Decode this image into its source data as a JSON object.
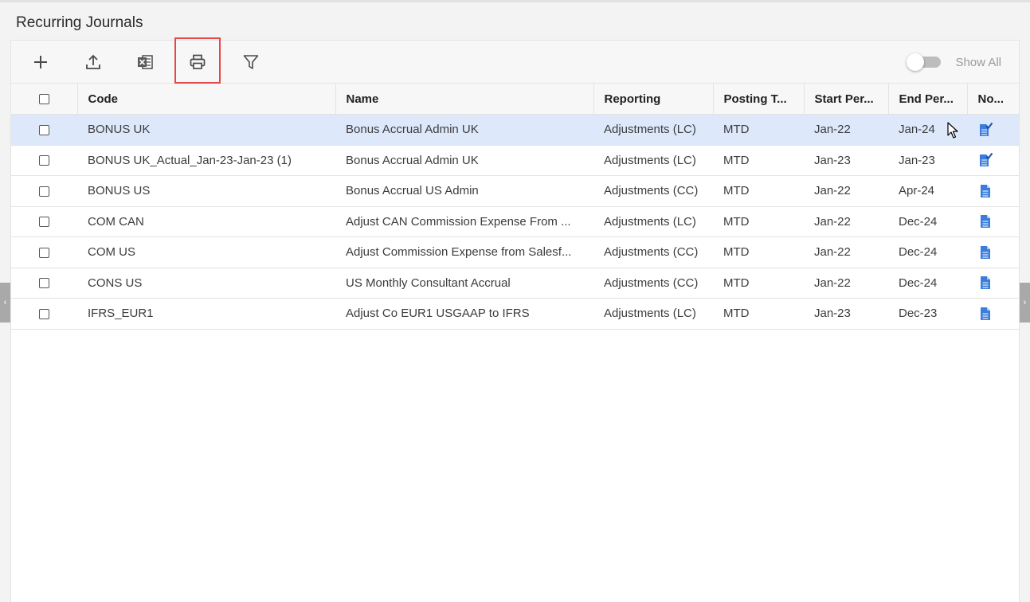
{
  "page": {
    "title": "Recurring Journals"
  },
  "toolbar": {
    "buttons": [
      {
        "name": "add-button",
        "icon": "plus-icon"
      },
      {
        "name": "upload-button",
        "icon": "upload-icon"
      },
      {
        "name": "excel-export-button",
        "icon": "excel-icon"
      },
      {
        "name": "print-button",
        "icon": "printer-icon"
      },
      {
        "name": "filter-button",
        "icon": "filter-icon"
      }
    ],
    "show_all_label": "Show All",
    "show_all_enabled": false
  },
  "table": {
    "columns": [
      "Code",
      "Name",
      "Reporting",
      "Posting T...",
      "Start Per...",
      "End Per...",
      "No..."
    ],
    "rows": [
      {
        "code": "BONUS UK",
        "name": "Bonus Accrual Admin UK",
        "reporting": "Adjustments (LC)",
        "posting": "MTD",
        "start": "Jan-22",
        "end": "Jan-24",
        "note_icon": "note-check-icon",
        "selected": true
      },
      {
        "code": "BONUS UK_Actual_Jan-23-Jan-23 (1)",
        "name": "Bonus Accrual Admin UK",
        "reporting": "Adjustments (LC)",
        "posting": "MTD",
        "start": "Jan-23",
        "end": "Jan-23",
        "note_icon": "note-check-icon",
        "selected": false
      },
      {
        "code": "BONUS US",
        "name": "Bonus Accrual US Admin",
        "reporting": "Adjustments (CC)",
        "posting": "MTD",
        "start": "Jan-22",
        "end": "Apr-24",
        "note_icon": "note-icon",
        "selected": false
      },
      {
        "code": "COM CAN",
        "name": "Adjust CAN Commission Expense From ...",
        "reporting": "Adjustments (LC)",
        "posting": "MTD",
        "start": "Jan-22",
        "end": "Dec-24",
        "note_icon": "note-icon",
        "selected": false
      },
      {
        "code": "COM US",
        "name": "Adjust Commission Expense from Salesf...",
        "reporting": "Adjustments (CC)",
        "posting": "MTD",
        "start": "Jan-22",
        "end": "Dec-24",
        "note_icon": "note-icon",
        "selected": false
      },
      {
        "code": "CONS US",
        "name": "US Monthly Consultant Accrual",
        "reporting": "Adjustments (CC)",
        "posting": "MTD",
        "start": "Jan-22",
        "end": "Dec-24",
        "note_icon": "note-icon",
        "selected": false
      },
      {
        "code": "IFRS_EUR1",
        "name": "Adjust Co EUR1 USGAAP to IFRS",
        "reporting": "Adjustments (LC)",
        "posting": "MTD",
        "start": "Jan-23",
        "end": "Dec-23",
        "note_icon": "note-icon",
        "selected": false
      }
    ]
  },
  "colors": {
    "selected_row": "#dde9fb",
    "highlight_border": "#e34949",
    "note_icon_blue": "#3b7ddd"
  }
}
